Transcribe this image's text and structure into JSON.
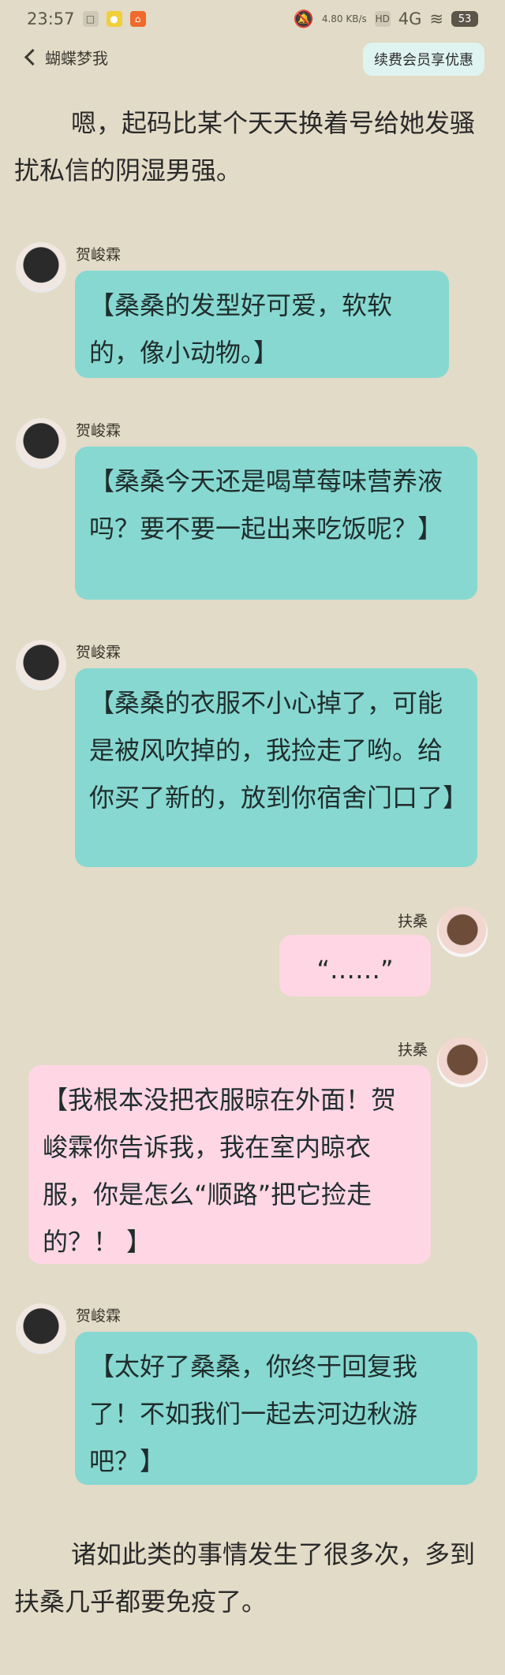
{
  "status": {
    "time": "23:57",
    "left_icons": [
      "app-icon-1",
      "app-icon-2",
      "app-icon-3"
    ],
    "network_speed": "4.80\nKB/s",
    "hd_label": "HD",
    "net_label": "4G",
    "battery": "53"
  },
  "nav": {
    "back_label": "蝴蝶梦我",
    "vip_label": "续费会员享优惠"
  },
  "content": {
    "para_top": "嗯，起码比某个天天换着号给她发骚扰私信的阴湿男强。",
    "para_bottom": "诸如此类的事情发生了很多次，多到扶桑几乎都要免疫了。"
  },
  "messages": [
    {
      "sender": "贺峻霖",
      "side": "left",
      "text": "【桑桑的发型好可爱，软软的，像小动物。】",
      "bubble_color": "#87d8d1",
      "avatar": "male-avatar"
    },
    {
      "sender": "贺峻霖",
      "side": "left",
      "text": "【桑桑今天还是喝草莓味营养液吗？要不要一起出来吃饭呢？】",
      "bubble_color": "#87d8d1",
      "avatar": "male-avatar"
    },
    {
      "sender": "贺峻霖",
      "side": "left",
      "text": "【桑桑的衣服不小心掉了，可能是被风吹掉的，我捡走了哟。给你买了新的，放到你宿舍门口了】",
      "bubble_color": "#87d8d1",
      "avatar": "male-avatar"
    },
    {
      "sender": "扶桑",
      "side": "right",
      "text": "“……”",
      "bubble_color": "#ffd6e3",
      "avatar": "female-avatar"
    },
    {
      "sender": "扶桑",
      "side": "right",
      "text": "【我根本没把衣服晾在外面！贺峻霖你告诉我，我在室内晾衣服，你是怎么“顺路”把它捡走的？！ 】",
      "bubble_color": "#ffd6e3",
      "avatar": "female-avatar"
    },
    {
      "sender": "贺峻霖",
      "side": "left",
      "text": "【太好了桑桑，你终于回复我了！不如我们一起去河边秋游吧？】",
      "bubble_color": "#87d8d1",
      "avatar": "male-avatar"
    }
  ]
}
